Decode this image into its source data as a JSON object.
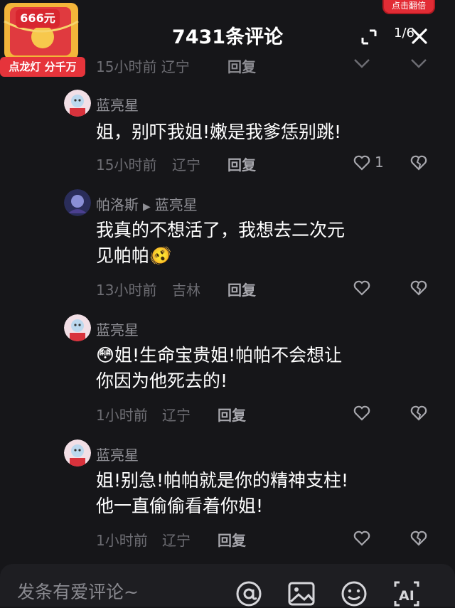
{
  "header": {
    "title": "7431条评论",
    "page_indicator": "1/6"
  },
  "promo": {
    "amount": "666元",
    "subtitle": "点龙灯 分千万",
    "double_badge": "点击翻倍"
  },
  "prev_comment": {
    "meta": "15小时前 辽宁",
    "reply_label": "回复"
  },
  "comments": [
    {
      "user": "蓝亮星",
      "reply_to": "",
      "text_lines": [
        "姐，别吓我姐!嫩是我爹恁别跳!"
      ],
      "time": "15小时前",
      "location": "辽宁",
      "reply_label": "回复",
      "likes": "1"
    },
    {
      "user": "帕洛斯",
      "reply_to": "蓝亮星",
      "text_lines": [
        "我真的不想活了，我想去二次元",
        "见帕帕🫨"
      ],
      "time": "13小时前",
      "location": "吉林",
      "reply_label": "回复",
      "likes": ""
    },
    {
      "user": "蓝亮星",
      "reply_to": "",
      "text_lines": [
        "😳姐!生命宝贵姐!帕帕不会想让",
        "你因为他死去的!"
      ],
      "time": "1小时前",
      "location": "辽宁",
      "reply_label": "回复",
      "likes": ""
    },
    {
      "user": "蓝亮星",
      "reply_to": "",
      "text_lines": [
        "姐!别急!帕帕就是你的精神支柱!",
        "他一直偷偷看着你姐!"
      ],
      "time": "1小时前",
      "location": "辽宁",
      "reply_label": "回复",
      "likes": ""
    }
  ],
  "input": {
    "placeholder": "发条有爱评论~"
  },
  "icons": {
    "expand": "expand-icon",
    "close": "close-icon",
    "like": "heart-outline-icon",
    "dislike": "broken-heart-icon",
    "mention": "at-icon",
    "image": "image-icon",
    "emoji": "emoji-icon",
    "ai": "ai-icon"
  },
  "colors": {
    "background": "#161619",
    "muted_text": "#6d6d73",
    "promo_red": "#e6343b"
  }
}
